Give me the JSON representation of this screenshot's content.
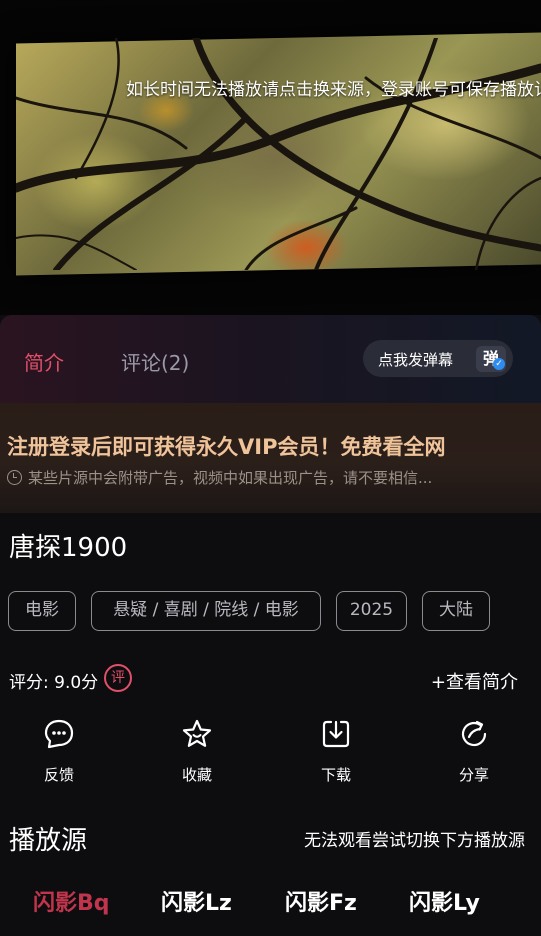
{
  "player": {
    "notice": "如长时间无法播放请点击换来源，登录账号可保存播放记录"
  },
  "tabs": {
    "intro": "简介",
    "comments": "评论(2)",
    "danmaku_button": "点我发弹幕",
    "danmaku_icon": "弹"
  },
  "promo": {
    "title": "注册登录后即可获得永久VIP会员！免费看全网",
    "subtitle": "某些片源中会附带广告，视频中如果出现广告，请不要相信..."
  },
  "movie": {
    "title": "唐探1900",
    "tags": [
      "电影",
      "悬疑 / 喜剧 / 院线 / 电影",
      "2025",
      "大陆"
    ],
    "score": "评分: 9.0分",
    "score_badge": "评",
    "view_intro": "+查看简介"
  },
  "actions": [
    {
      "label": "反馈",
      "icon": "feedback-icon"
    },
    {
      "label": "收藏",
      "icon": "star-icon"
    },
    {
      "label": "下载",
      "icon": "download-icon"
    },
    {
      "label": "分享",
      "icon": "share-icon"
    }
  ],
  "sources": {
    "title": "播放源",
    "hint": "无法观看尝试切换下方播放源",
    "items": [
      "闪影Bq",
      "闪影Lz",
      "闪影Fz",
      "闪影Ly"
    ],
    "active_index": 0
  },
  "colors": {
    "accent": "#e05068",
    "active_source": "#c0354c",
    "promo_title": "#f0c49a"
  }
}
